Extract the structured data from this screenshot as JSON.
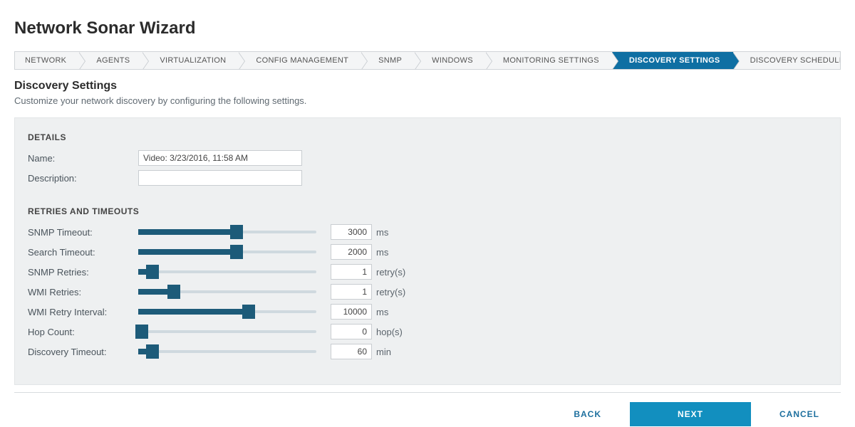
{
  "title": "Network Sonar Wizard",
  "steps": [
    {
      "label": "NETWORK",
      "active": false
    },
    {
      "label": "AGENTS",
      "active": false
    },
    {
      "label": "VIRTUALIZATION",
      "active": false
    },
    {
      "label": "CONFIG MANAGEMENT",
      "active": false
    },
    {
      "label": "SNMP",
      "active": false
    },
    {
      "label": "WINDOWS",
      "active": false
    },
    {
      "label": "MONITORING SETTINGS",
      "active": false
    },
    {
      "label": "DISCOVERY SETTINGS",
      "active": true
    },
    {
      "label": "DISCOVERY SCHEDULING",
      "active": false
    }
  ],
  "section": {
    "title": "Discovery Settings",
    "subtitle": "Customize your network discovery by configuring the following settings."
  },
  "details": {
    "header": "DETAILS",
    "name_label": "Name:",
    "name_value": "Video: 3/23/2016, 11:58 AM",
    "description_label": "Description:",
    "description_value": ""
  },
  "retries": {
    "header": "RETRIES AND TIMEOUTS",
    "rows": [
      {
        "label": "SNMP Timeout:",
        "value": "3000",
        "unit": "ms",
        "pct": 55
      },
      {
        "label": "Search Timeout:",
        "value": "2000",
        "unit": "ms",
        "pct": 55
      },
      {
        "label": "SNMP Retries:",
        "value": "1",
        "unit": "retry(s)",
        "pct": 8
      },
      {
        "label": "WMI Retries:",
        "value": "1",
        "unit": "retry(s)",
        "pct": 20
      },
      {
        "label": "WMI Retry Interval:",
        "value": "10000",
        "unit": "ms",
        "pct": 62
      },
      {
        "label": "Hop Count:",
        "value": "0",
        "unit": "hop(s)",
        "pct": 2
      },
      {
        "label": "Discovery Timeout:",
        "value": "60",
        "unit": "min",
        "pct": 8
      }
    ]
  },
  "footer": {
    "back": "BACK",
    "next": "NEXT",
    "cancel": "CANCEL"
  }
}
